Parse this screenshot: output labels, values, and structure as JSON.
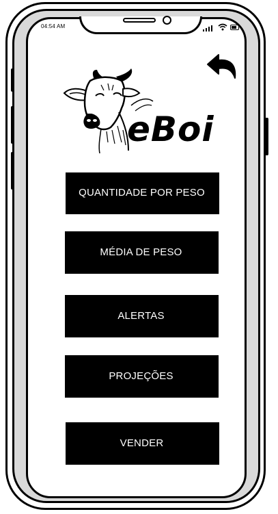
{
  "status_bar": {
    "time": "04:54 AM",
    "signal_icon": "signal-icon",
    "wifi_icon": "wifi-icon",
    "battery_icon": "battery-icon"
  },
  "header": {
    "back_icon": "back-arrow-icon"
  },
  "logo": {
    "text": "eBoi",
    "image": "cow-head-logo"
  },
  "menu": {
    "items": [
      {
        "label": "QUANTIDADE POR PESO"
      },
      {
        "label": "MÉDIA DE PESO"
      },
      {
        "label": "ALERTAS"
      },
      {
        "label": "PROJEÇÕES"
      },
      {
        "label": "VENDER"
      }
    ]
  },
  "colors": {
    "button_bg": "#000000",
    "button_text": "#ffffff",
    "frame_band": "#d9d9d9"
  }
}
